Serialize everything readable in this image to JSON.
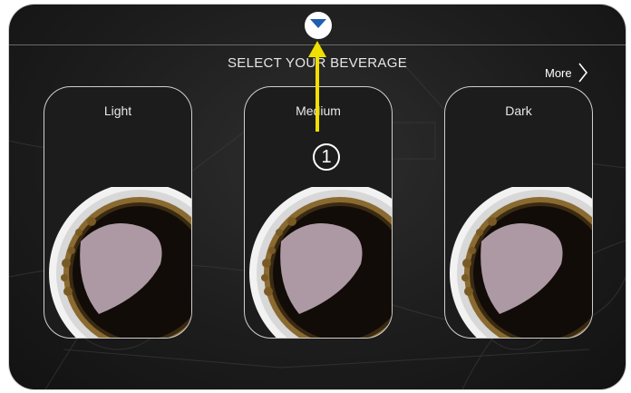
{
  "screen": {
    "title": "SELECT YOUR BEVERAGE",
    "more_label": "More",
    "accent_color": "#1f5fb0",
    "highlight_color": "#f0e000"
  },
  "beverages": [
    {
      "label": "Light",
      "image": "coffee-cup-top-view"
    },
    {
      "label": "Medium",
      "image": "coffee-cup-top-view"
    },
    {
      "label": "Dark",
      "image": "coffee-cup-top-view"
    }
  ],
  "annotation": {
    "step_number": "1",
    "arrow_direction": "up",
    "target": "pull-down-handle"
  }
}
